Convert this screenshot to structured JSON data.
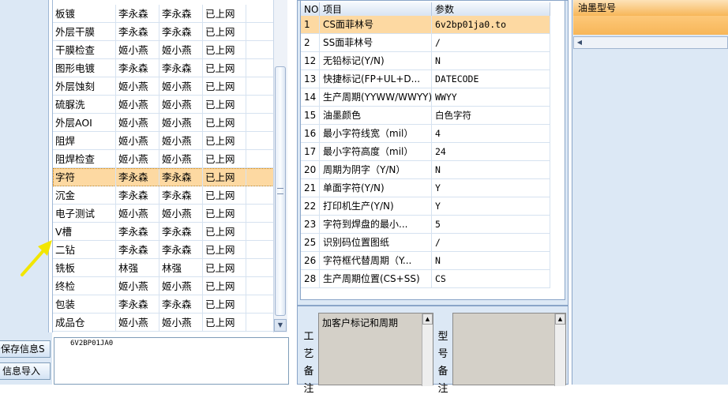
{
  "sidebar": {
    "save_button": "保存信息S",
    "import_button": "信息导入"
  },
  "process_table": {
    "rows": [
      [
        "板镀",
        "李永森",
        "李永森",
        "已上网"
      ],
      [
        "外层干膜",
        "李永森",
        "李永森",
        "已上网"
      ],
      [
        "干膜检查",
        "姬小燕",
        "姬小燕",
        "已上网"
      ],
      [
        "图形电镀",
        "李永森",
        "李永森",
        "已上网"
      ],
      [
        "外层蚀刻",
        "姬小燕",
        "姬小燕",
        "已上网"
      ],
      [
        "硫脲洗",
        "姬小燕",
        "姬小燕",
        "已上网"
      ],
      [
        "外层AOI",
        "姬小燕",
        "姬小燕",
        "已上网"
      ],
      [
        "阻焊",
        "姬小燕",
        "姬小燕",
        "已上网"
      ],
      [
        "阻焊检查",
        "姬小燕",
        "姬小燕",
        "已上网"
      ],
      [
        "字符",
        "李永森",
        "李永森",
        "已上网"
      ],
      [
        "沉金",
        "李永森",
        "李永森",
        "已上网"
      ],
      [
        "电子测试",
        "姬小燕",
        "姬小燕",
        "已上网"
      ],
      [
        "V槽",
        "李永森",
        "李永森",
        "已上网"
      ],
      [
        "二钻",
        "李永森",
        "李永森",
        "已上网"
      ],
      [
        "铣板",
        "林强",
        "林强",
        "已上网"
      ],
      [
        "终检",
        "姬小燕",
        "姬小燕",
        "已上网"
      ],
      [
        "包装",
        "李永森",
        "李永森",
        "已上网"
      ],
      [
        "成品仓",
        "姬小燕",
        "姬小燕",
        "已上网"
      ]
    ],
    "selected_index": 9
  },
  "info_box": {
    "text": "6V2BP01JA0"
  },
  "params_table": {
    "headers": [
      "NO",
      "项目",
      "参数"
    ],
    "rows": [
      [
        "1",
        "CS面菲林号",
        "6v2bp01ja0.to"
      ],
      [
        "2",
        "SS面菲林号",
        "/"
      ],
      [
        "12",
        "无铅标记(Y/N)",
        "N"
      ],
      [
        "13",
        "快捷标记(FP+UL+D...",
        "DATECODE"
      ],
      [
        "14",
        "生产周期(YYWW/WWYY)",
        "WWYY"
      ],
      [
        "15",
        "油墨颜色",
        "白色字符"
      ],
      [
        "16",
        "最小字符线宽（mil）",
        "4"
      ],
      [
        "17",
        "最小字符高度（mil）",
        "24"
      ],
      [
        "20",
        "周期为阴字（Y/N）",
        "N"
      ],
      [
        "21",
        "单面字符(Y/N)",
        "Y"
      ],
      [
        "22",
        "打印机生产(Y/N)",
        "Y"
      ],
      [
        "23",
        "字符到焊盘的最小...",
        "5"
      ],
      [
        "25",
        "识别码位置图纸",
        "/"
      ],
      [
        "26",
        "字符框代替周期（Y...",
        "N"
      ],
      [
        "28",
        "生产周期位置(CS+SS)",
        "CS"
      ]
    ],
    "selected_index": 0
  },
  "notes": {
    "process_label": "工艺备注",
    "process_text": "加客户标记和周期",
    "model_label": "型号备注"
  },
  "ink_panel": {
    "header": "油墨型号"
  },
  "colors": {
    "selection": "#fdd9a2",
    "panel_bg": "#dce8f5",
    "header_orange": "#f7b658",
    "arrow": "#f2e600"
  }
}
